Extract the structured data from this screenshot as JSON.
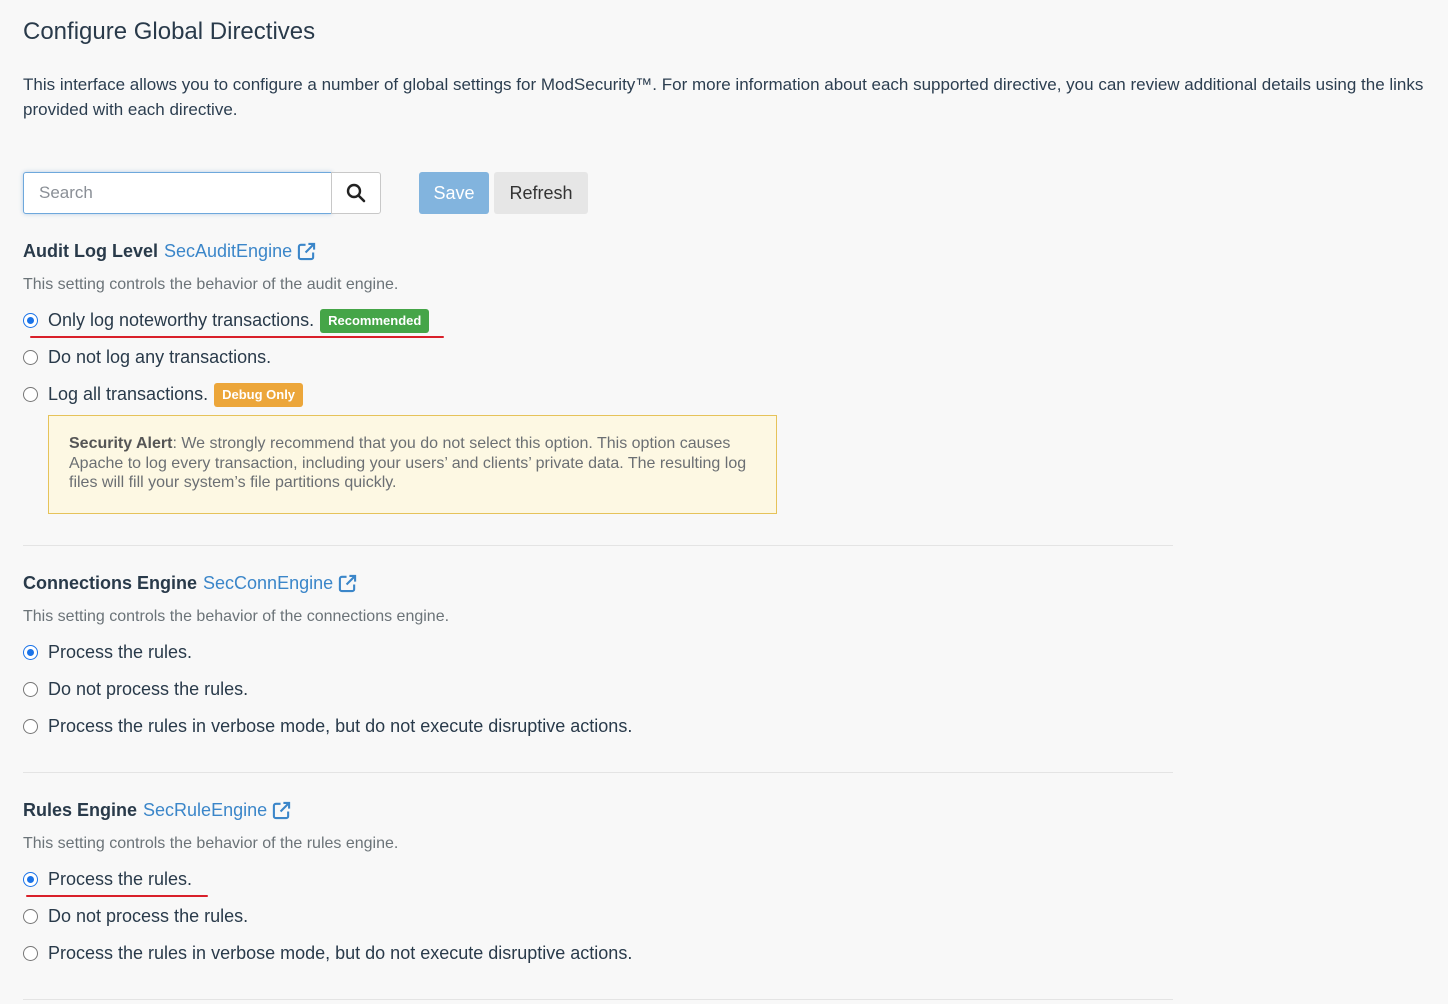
{
  "page": {
    "title": "Configure Global Directives",
    "intro": "This interface allows you to configure a number of global settings for ModSecurity™. For more information about each supported directive, you can review additional details using the links provided with each directive."
  },
  "toolbar": {
    "search_placeholder": "Search",
    "search_value": "",
    "save_label": "Save",
    "refresh_label": "Refresh"
  },
  "sections": [
    {
      "title": "Audit Log Level",
      "directive": "SecAuditEngine",
      "description": "This setting controls the behavior of the audit engine.",
      "options": [
        {
          "label": "Only log noteworthy transactions.",
          "checked": true,
          "badge": "Recommended"
        },
        {
          "label": "Do not log any transactions.",
          "checked": false
        },
        {
          "label": "Log all transactions.",
          "checked": false,
          "badge": "Debug Only"
        }
      ],
      "alert": {
        "title": "Security Alert",
        "text": ": We strongly recommend that you do not select this option. This option causes Apache to log every transaction, including your users’ and clients’ private data. The resulting log files will fill your system’s file partitions quickly."
      }
    },
    {
      "title": "Connections Engine",
      "directive": "SecConnEngine",
      "description": "This setting controls the behavior of the connections engine.",
      "options": [
        {
          "label": "Process the rules.",
          "checked": true
        },
        {
          "label": "Do not process the rules.",
          "checked": false
        },
        {
          "label": "Process the rules in verbose mode, but do not execute disruptive actions.",
          "checked": false
        }
      ]
    },
    {
      "title": "Rules Engine",
      "directive": "SecRuleEngine",
      "description": "This setting controls the behavior of the rules engine.",
      "options": [
        {
          "label": "Process the rules.",
          "checked": true
        },
        {
          "label": "Do not process the rules.",
          "checked": false
        },
        {
          "label": "Process the rules in verbose mode, but do not execute disruptive actions.",
          "checked": false
        }
      ]
    }
  ],
  "colors": {
    "link": "#3b86c9",
    "recommended_badge": "#45a548",
    "debug_badge": "#eca63a",
    "annotation_underline": "#d9202a"
  }
}
